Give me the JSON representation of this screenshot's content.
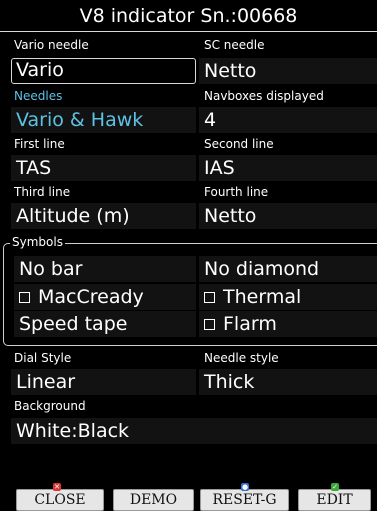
{
  "title": "V8 indicator Sn.:00668",
  "fields": {
    "vario_needle": {
      "label": "Vario needle",
      "value": "Vario"
    },
    "sc_needle": {
      "label": "SC needle",
      "value": "Netto"
    },
    "needles": {
      "label": "Needles",
      "value": "Vario & Hawk"
    },
    "navboxes": {
      "label": "Navboxes displayed",
      "value": "4"
    },
    "first_line": {
      "label": "First line",
      "value": "TAS"
    },
    "second_line": {
      "label": "Second line",
      "value": "IAS"
    },
    "third_line": {
      "label": "Third line",
      "value": "Altitude (m)"
    },
    "fourth_line": {
      "label": "Fourth line",
      "value": "Netto"
    }
  },
  "symbols": {
    "legend": "Symbols",
    "bar": "No bar",
    "diamond": "No diamond",
    "maccready": "MacCready",
    "thermal": "Thermal",
    "speed_tape": "Speed tape",
    "flarm": "Flarm"
  },
  "dial": {
    "dial_style": {
      "label": "Dial Style",
      "value": "Linear"
    },
    "needle_style": {
      "label": "Needle style",
      "value": "Thick"
    },
    "background": {
      "label": "Background",
      "value": "White:Black"
    }
  },
  "buttons": {
    "close": "CLOSE",
    "demo": "DEMO",
    "reset": "RESET-G",
    "edit": "EDIT"
  },
  "colors": {
    "accent": "#5ec2e6",
    "close_marker": "#d93636",
    "reset_marker": "#2f6fd6",
    "edit_marker": "#3aa83a"
  }
}
